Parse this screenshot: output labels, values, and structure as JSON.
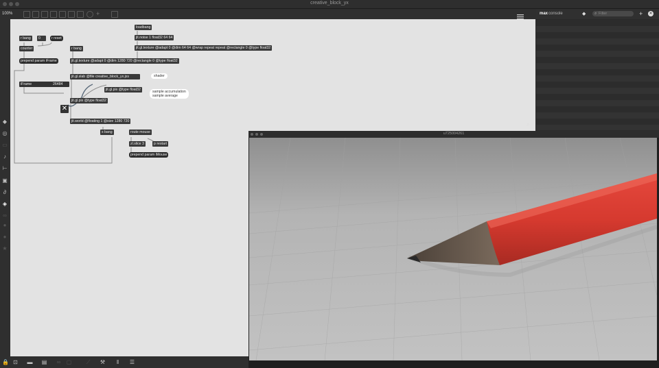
{
  "window": {
    "title": "creative_block_yx"
  },
  "toolbar": {
    "zoom": "100%"
  },
  "console": {
    "title_bold": "max",
    "title_rest": "console",
    "filter_placeholder": "Filter"
  },
  "render_window": {
    "title": "u725004261"
  },
  "patch": {
    "objects": {
      "r_bang_1": "r bang",
      "number_box": "0",
      "r_reset": "r reset",
      "counter": "counter",
      "r_bang_2": "r bang",
      "prepend_iframe": "prepend param iFrame",
      "loadbang": "loadbang",
      "jit_noise": "jit.noise 1 float32 64 64",
      "jit_texture_1": "jit.gl.texture @adapt 0 @dim 64 64 @wrap repeat repeat @rectangle 0 @type float32",
      "jit_texture_2": "jit.gl.texture @adapt 0 @dim 1280 720 @rectangle 0 @type float32",
      "jit_slab": "jit.gl.slab @file creative_block_yx.jxs",
      "iframe_label": "iFrame",
      "iframe_value": "26484",
      "jit_pix_1": "jit.gl.pix @type float32",
      "jit_pix_2": "jit.gl.pix @type float32",
      "jit_world": "jit.world @floating 1 @size 1280 720",
      "s_bang": "s bang",
      "route_mouse": "route mouse",
      "zl_slice": "zl.slice 3",
      "p_restart": "p restart",
      "prepend_imouse": "prepend param iMouse"
    },
    "comments": {
      "shader": "shader",
      "accumulation_line1": "sample accumulation",
      "accumulation_line2": "sample average"
    }
  }
}
